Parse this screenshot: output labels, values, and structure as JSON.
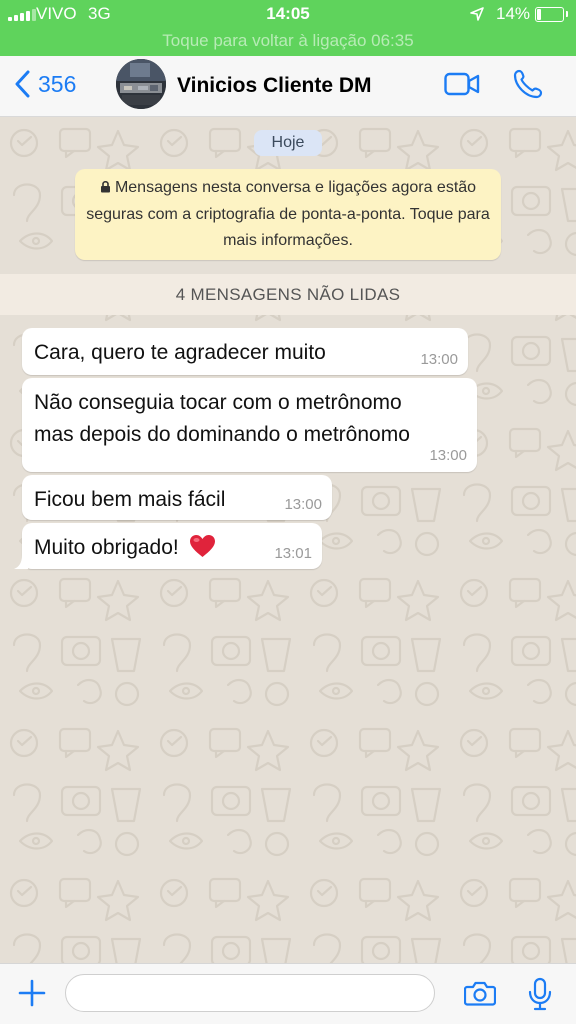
{
  "status_bar": {
    "carrier": "VIVO",
    "network": "3G",
    "time": "14:05",
    "battery": "14%",
    "battery_level": 0.14,
    "call_banner": "Toque para voltar à ligação 06:35"
  },
  "nav": {
    "back_count": "356",
    "contact_name": "Vinicios Cliente DM",
    "icons": [
      "chevron-left-icon",
      "video-call-icon",
      "phone-icon"
    ]
  },
  "chat": {
    "date_label": "Hoje",
    "security_notice": "Mensagens nesta conversa e ligações agora estão seguras com a criptografia de ponta-a-ponta. Toque para mais informações.",
    "unread_banner": "4 MENSAGENS NÃO LIDAS",
    "messages": [
      {
        "lines": [
          "Cara, quero te agradecer muito"
        ],
        "time": "13:00"
      },
      {
        "lines": [
          "Não conseguia tocar com o metrônomo",
          "mas depois do dominando o metrônomo"
        ],
        "time": "13:00"
      },
      {
        "lines": [
          "Ficou bem mais fácil"
        ],
        "time": "13:00"
      },
      {
        "text": "Muito obrigado!",
        "emoji": "❤️",
        "time": "13:01"
      }
    ]
  },
  "composer": {
    "placeholder": "",
    "icons": [
      "plus-icon",
      "camera-icon",
      "microphone-icon"
    ]
  },
  "colors": {
    "status_green": "#5fd35c",
    "ios_blue": "#1c7cf4",
    "chat_background": "#e5dfd6",
    "notice_yellow": "#fdf3c4",
    "date_pill": "#dbe5f6",
    "heart_red": "#e0233b"
  }
}
